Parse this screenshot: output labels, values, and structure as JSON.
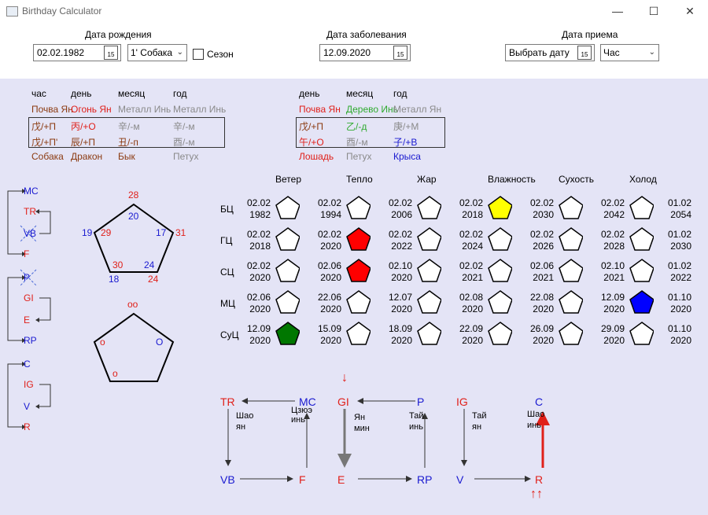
{
  "window": {
    "title": "Birthday Calculator",
    "min": "—",
    "max": "☐",
    "close": "✕"
  },
  "top": {
    "birth": {
      "label": "Дата рождения",
      "date": "02.02.1982",
      "animal": "1' Собака",
      "season_label": "Сезон"
    },
    "illness": {
      "label": "Дата заболевания",
      "date": "12.09.2020"
    },
    "reception": {
      "label": "Дата приема",
      "date": "Выбрать дату",
      "hour": "Час"
    },
    "cal_icon": "15"
  },
  "left_table": {
    "headers": [
      "час",
      "день",
      "месяц",
      "год"
    ],
    "elements": [
      "Почва Ян",
      "Огонь Ян",
      "Металл Инь",
      "Металл Инь"
    ],
    "stems": [
      "戊/+П",
      "丙/+О",
      "辛/-м",
      "辛/-м"
    ],
    "branches": [
      "戊/+П'",
      "辰/+П",
      "丑/-п",
      "酉/-м"
    ],
    "animals": [
      "Собака",
      "Дракон",
      "Бык",
      "Петух"
    ]
  },
  "right_table": {
    "headers": [
      "день",
      "месяц",
      "год"
    ],
    "elements": [
      "Почва Ян",
      "Дерево Инь",
      "Металл Ян"
    ],
    "stems": [
      "戊/+П",
      "乙/-д",
      "庚/+М"
    ],
    "branches": [
      "午/+О",
      "酉/-м",
      "子/+В"
    ],
    "animals": [
      "Лошадь",
      "Петух",
      "Крыса"
    ]
  },
  "side_chain": {
    "g1": [
      "MC",
      "TR",
      "VB",
      "F"
    ],
    "g2": [
      "P",
      "GI",
      "E",
      "RP"
    ],
    "g3": [
      "C",
      "IG",
      "V",
      "R"
    ]
  },
  "pentagon1": {
    "top": "28",
    "top_inner": "20",
    "left_out": "19",
    "left_in": "29",
    "right_in": "17",
    "right_out": "31",
    "bl_in": "30",
    "bl_out": "18",
    "br_in": "24",
    "br_out": "24"
  },
  "pentagon2": {
    "top": "oo",
    "left": "o",
    "right": "O",
    "bottom": "o"
  },
  "grid": {
    "columns": [
      "Ветер",
      "Тепло",
      "Жар",
      "Влажность",
      "Сухость",
      "Холод"
    ],
    "rows": [
      {
        "label": "БЦ",
        "cells": [
          {
            "d": "02.02",
            "y": "1982",
            "fill": "#ffffff"
          },
          {
            "d": "02.02",
            "y": "1994",
            "fill": "#ffffff"
          },
          {
            "d": "02.02",
            "y": "2006",
            "fill": "#ffffff"
          },
          {
            "d": "02.02",
            "y": "2018",
            "fill": "#ffff00"
          },
          {
            "d": "02.02",
            "y": "2030",
            "fill": "#ffffff"
          },
          {
            "d": "02.02",
            "y": "2042",
            "fill": "#ffffff"
          }
        ],
        "end": {
          "d": "01.02",
          "y": "2054"
        }
      },
      {
        "label": "ГЦ",
        "cells": [
          {
            "d": "02.02",
            "y": "2018",
            "fill": "#ffffff"
          },
          {
            "d": "02.02",
            "y": "2020",
            "fill": "#ff0000"
          },
          {
            "d": "02.02",
            "y": "2022",
            "fill": "#ffffff"
          },
          {
            "d": "02.02",
            "y": "2024",
            "fill": "#ffffff"
          },
          {
            "d": "02.02",
            "y": "2026",
            "fill": "#ffffff"
          },
          {
            "d": "02.02",
            "y": "2028",
            "fill": "#ffffff"
          }
        ],
        "end": {
          "d": "01.02",
          "y": "2030"
        }
      },
      {
        "label": "СЦ",
        "cells": [
          {
            "d": "02.02",
            "y": "2020",
            "fill": "#ffffff"
          },
          {
            "d": "02.06",
            "y": "2020",
            "fill": "#ff0000"
          },
          {
            "d": "02.10",
            "y": "2020",
            "fill": "#ffffff"
          },
          {
            "d": "02.02",
            "y": "2021",
            "fill": "#ffffff"
          },
          {
            "d": "02.06",
            "y": "2021",
            "fill": "#ffffff"
          },
          {
            "d": "02.10",
            "y": "2021",
            "fill": "#ffffff"
          }
        ],
        "end": {
          "d": "01.02",
          "y": "2022"
        }
      },
      {
        "label": "МЦ",
        "cells": [
          {
            "d": "02.06",
            "y": "2020",
            "fill": "#ffffff"
          },
          {
            "d": "22.06",
            "y": "2020",
            "fill": "#ffffff"
          },
          {
            "d": "12.07",
            "y": "2020",
            "fill": "#ffffff"
          },
          {
            "d": "02.08",
            "y": "2020",
            "fill": "#ffffff"
          },
          {
            "d": "22.08",
            "y": "2020",
            "fill": "#ffffff"
          },
          {
            "d": "12.09",
            "y": "2020",
            "fill": "#0000ff"
          }
        ],
        "end": {
          "d": "01.10",
          "y": "2020"
        }
      },
      {
        "label": "СуЦ",
        "cells": [
          {
            "d": "12.09",
            "y": "2020",
            "fill": "#007700"
          },
          {
            "d": "15.09",
            "y": "2020",
            "fill": "#ffffff"
          },
          {
            "d": "18.09",
            "y": "2020",
            "fill": "#ffffff"
          },
          {
            "d": "22.09",
            "y": "2020",
            "fill": "#ffffff"
          },
          {
            "d": "26.09",
            "y": "2020",
            "fill": "#ffffff"
          },
          {
            "d": "29.09",
            "y": "2020",
            "fill": "#ffffff"
          }
        ],
        "end": {
          "d": "01.10",
          "y": "2020"
        }
      }
    ]
  },
  "bottom": {
    "sq1": {
      "tl": "TR",
      "tr": "MC",
      "bl": "VB",
      "br": "F",
      "left_v": "Шао ян",
      "right_v": "Цзюэ инь"
    },
    "sq2": {
      "tl": "GI",
      "tr": "P",
      "bl": "E",
      "br": "RP",
      "left_v": "Ян мин",
      "right_v": "Тай инь",
      "top_mark": "↓"
    },
    "sq3": {
      "tl": "IG",
      "tr": "C",
      "bl": "V",
      "br": "R",
      "left_v": "Тай ян",
      "right_v": "Шао инь",
      "bottom_mark": "↑↑"
    }
  }
}
